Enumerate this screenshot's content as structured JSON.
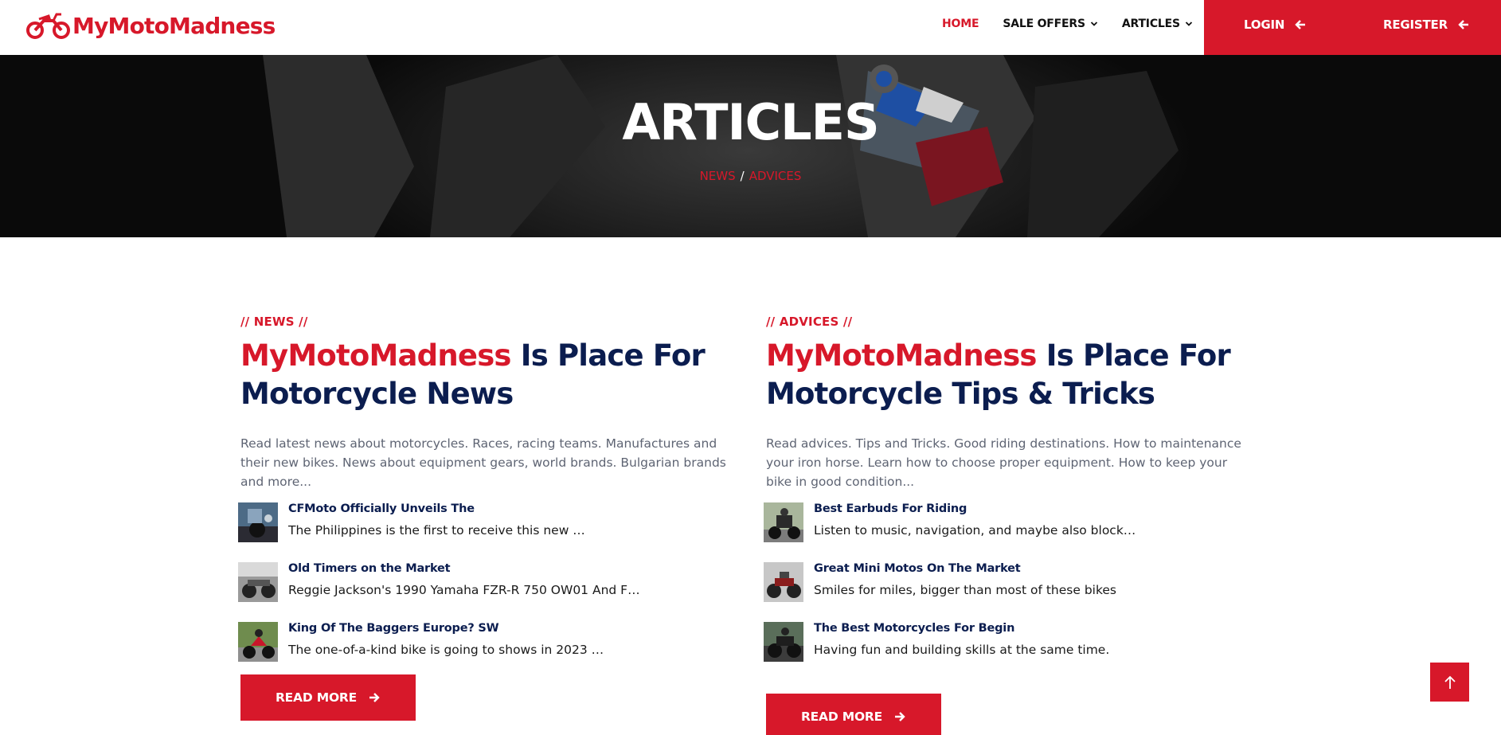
{
  "brand": {
    "name": "MyMotoMadness",
    "color": "#d7182a",
    "logo_icon": "motorcycle-icon"
  },
  "nav": {
    "items": [
      {
        "label": "HOME",
        "active": true,
        "has_dropdown": false
      },
      {
        "label": "SALE OFFERS",
        "active": false,
        "has_dropdown": true
      },
      {
        "label": "ARTICLES",
        "active": false,
        "has_dropdown": true
      }
    ],
    "login_label": "LOGIN",
    "register_label": "REGISTER"
  },
  "hero": {
    "title": "ARTICLES",
    "breadcrumb": [
      "NEWS",
      "ADVICES"
    ],
    "separator": "/"
  },
  "columns": [
    {
      "eyebrow": "// NEWS //",
      "heading_brand": "MyMotoMadness",
      "heading_rest_line1": " Is Place For",
      "heading_line2": "Motorcycle News",
      "description": "Read latest news about motorcycles. Races, racing teams. Manufactures and their new bikes. News about equipment gears, world brands. Bulgarian brands and more...",
      "items": [
        {
          "title": "CFMoto Officially Unveils The",
          "excerpt": "The Philippines is the first to receive this new …"
        },
        {
          "title": "Old Timers on the Market",
          "excerpt": "Reggie Jackson's 1990 Yamaha FZR-R 750 OW01 And F…"
        },
        {
          "title": "King Of The Baggers Europe? SW",
          "excerpt": "The one-of-a-kind bike is going to shows in 2023 …"
        }
      ],
      "read_more": "READ MORE"
    },
    {
      "eyebrow": "// ADVICES //",
      "heading_brand": "MyMotoMadness",
      "heading_rest_line1": " Is Place For",
      "heading_line2": "Motorcycle Tips & Tricks",
      "description": "Read advices. Tips and Tricks. Good riding destinations. How to maintenance your iron horse. Learn how to choose proper equipment. How to keep your bike in good condition...",
      "items": [
        {
          "title": "Best Earbuds For Riding",
          "excerpt": "Listen to music, navigation, and maybe also block…"
        },
        {
          "title": "Great Mini Motos On The Market",
          "excerpt": "Smiles for miles, bigger than most of these bikes"
        },
        {
          "title": "The Best Motorcycles For Begin",
          "excerpt": "Having fun and building skills at the same time."
        }
      ],
      "read_more": "READ MORE"
    }
  ],
  "icons": {
    "arrow_left": "arrow-left-icon",
    "arrow_right": "arrow-right-icon",
    "back_to_top": "arrow-up-icon",
    "chevron": "chevron-down-icon"
  },
  "colors": {
    "accent": "#d7182a",
    "navy": "#0b1d4f",
    "muted": "#5e6473"
  }
}
